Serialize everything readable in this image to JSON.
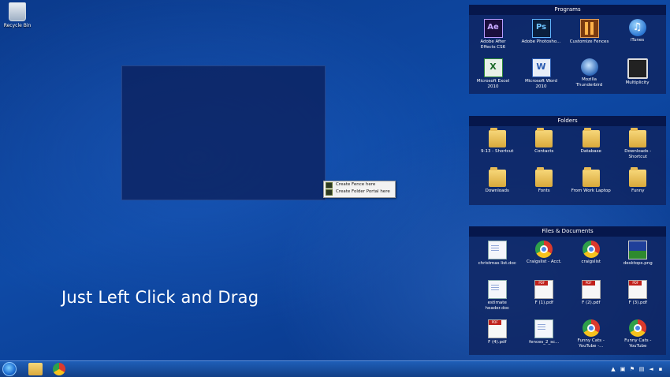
{
  "desktop": {
    "recycle_bin_label": "Recycle Bin",
    "caption": "Just Left Click and Drag"
  },
  "context_menu": {
    "items": [
      "Create Fence here",
      "Create Folder Portal here"
    ]
  },
  "fences": {
    "programs": {
      "title": "Programs",
      "items": [
        {
          "label": "Adobe After Effects CS6",
          "icon": "after-effects-icon",
          "glyph": "Ae"
        },
        {
          "label": "Adobe Photosho...",
          "icon": "photoshop-icon",
          "glyph": "Ps"
        },
        {
          "label": "Customize Fences",
          "icon": "fences-icon"
        },
        {
          "label": "iTunes",
          "icon": "itunes-icon",
          "glyph": "♫"
        },
        {
          "label": "Microsoft Excel 2010",
          "icon": "excel-icon",
          "glyph": "X"
        },
        {
          "label": "Microsoft Word 2010",
          "icon": "word-icon",
          "glyph": "W"
        },
        {
          "label": "Mozilla Thunderbird",
          "icon": "thunderbird-icon"
        },
        {
          "label": "Multiplicity",
          "icon": "multiplicity-icon"
        }
      ]
    },
    "folders": {
      "title": "Folders",
      "items": [
        {
          "label": "9-13 - Shortcut",
          "icon": "folder-shortcut-icon"
        },
        {
          "label": "Contacts",
          "icon": "folder-icon"
        },
        {
          "label": "Database",
          "icon": "folder-icon"
        },
        {
          "label": "Downloads - Shortcut",
          "icon": "folder-shortcut-icon"
        },
        {
          "label": "Downloads",
          "icon": "folder-download-icon"
        },
        {
          "label": "Fonts",
          "icon": "folder-icon"
        },
        {
          "label": "From Work Laptop",
          "icon": "folder-icon"
        },
        {
          "label": "Funny",
          "icon": "folder-icon"
        }
      ]
    },
    "files": {
      "title": "Files & Documents",
      "items": [
        {
          "label": "christmas list.doc",
          "icon": "word-doc-icon"
        },
        {
          "label": "Craigslist - Acct.",
          "icon": "chrome-icon"
        },
        {
          "label": "craigslist",
          "icon": "chrome-icon"
        },
        {
          "label": "desktops.png",
          "icon": "image-icon"
        },
        {
          "label": "estimate header.doc",
          "icon": "word-doc-icon"
        },
        {
          "label": "F (1).pdf",
          "icon": "pdf-icon"
        },
        {
          "label": "F (2).pdf",
          "icon": "pdf-icon"
        },
        {
          "label": "F (3).pdf",
          "icon": "pdf-icon"
        },
        {
          "label": "F (4).pdf",
          "icon": "pdf-icon"
        },
        {
          "label": "fences_2_sc...",
          "icon": "word-doc-icon"
        },
        {
          "label": "Funny Cats - YouTube -...",
          "icon": "chrome-icon"
        },
        {
          "label": "Funny Cats - YouTube",
          "icon": "chrome-icon"
        }
      ]
    }
  },
  "taskbar": {
    "tray_icons": [
      "up-arrow-icon",
      "monitor-icon",
      "flag-icon",
      "network-icon",
      "volume-icon",
      "show-desktop-icon"
    ]
  }
}
